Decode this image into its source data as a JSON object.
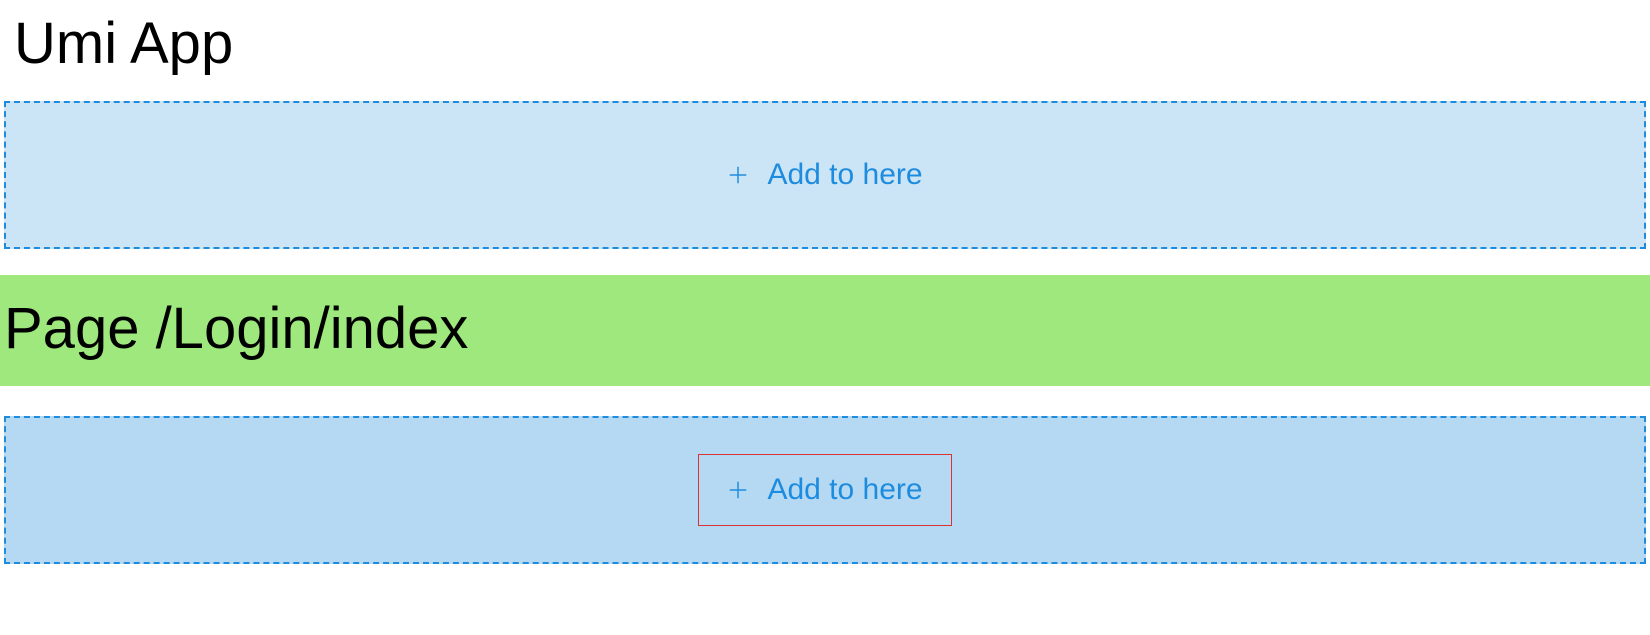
{
  "app": {
    "title": "Umi App"
  },
  "dropzones": {
    "top": {
      "label": "Add to here"
    },
    "bottom": {
      "label": "Add to here"
    }
  },
  "page": {
    "banner": "Page /Login/index"
  },
  "colors": {
    "dropzone_bg_light": "#cce5f6",
    "dropzone_bg_dark": "#b5d9f3",
    "dropzone_border": "#1e8cde",
    "link_text": "#1e8cde",
    "page_banner_bg": "#9fe87d",
    "highlight_border": "#d93333"
  }
}
